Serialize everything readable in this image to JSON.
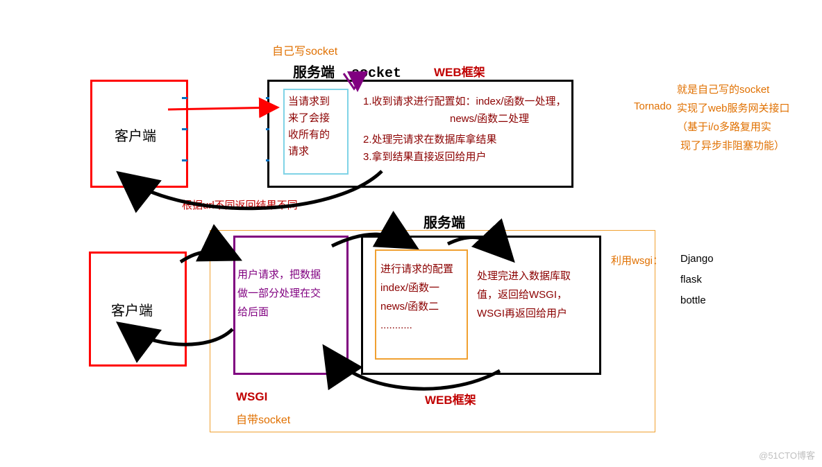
{
  "top": {
    "self_socket": "自己写socket",
    "server_title": "服务端  socket",
    "web_framework_label": "WEB框架",
    "client_label": "客户端",
    "socket_box": "当请求到\n来了会接\n收所有的\n请求",
    "framework_line1": "1.收到请求进行配置如：index/函数一处理，",
    "framework_line1b": "news/函数二处理",
    "framework_line2": "2.处理完请求在数据库拿结果",
    "framework_line3": "3.拿到结果直接返回给用户",
    "url_note": "根据url不同返回结果不同"
  },
  "right_top": {
    "tornado": "Tornado",
    "line1": "就是自己写的socket",
    "line2": "实现了web服务网关接口",
    "line3": "（基于i/o多路复用实",
    "line4": "现了异步非阻塞功能）"
  },
  "bottom": {
    "server_title": "服务端",
    "client_label": "客户端",
    "wsgi_box": "用户请求，把数据\n做一部分处理在交\n给后面",
    "config_box": "进行请求的配置\nindex/函数一\nnews/函数二\n...........",
    "process_box": "处理完进入数据库取\n值，返回给WSGI，\nWSGI再返回给用户",
    "wsgi_label": "WSGI",
    "self_socket": "自带socket",
    "web_framework_label": "WEB框架"
  },
  "right_bottom": {
    "using_wsgi": "利用wsgi：",
    "django": "Django",
    "flask": "flask",
    "bottle": "bottle"
  },
  "watermark": "@51CTO博客"
}
